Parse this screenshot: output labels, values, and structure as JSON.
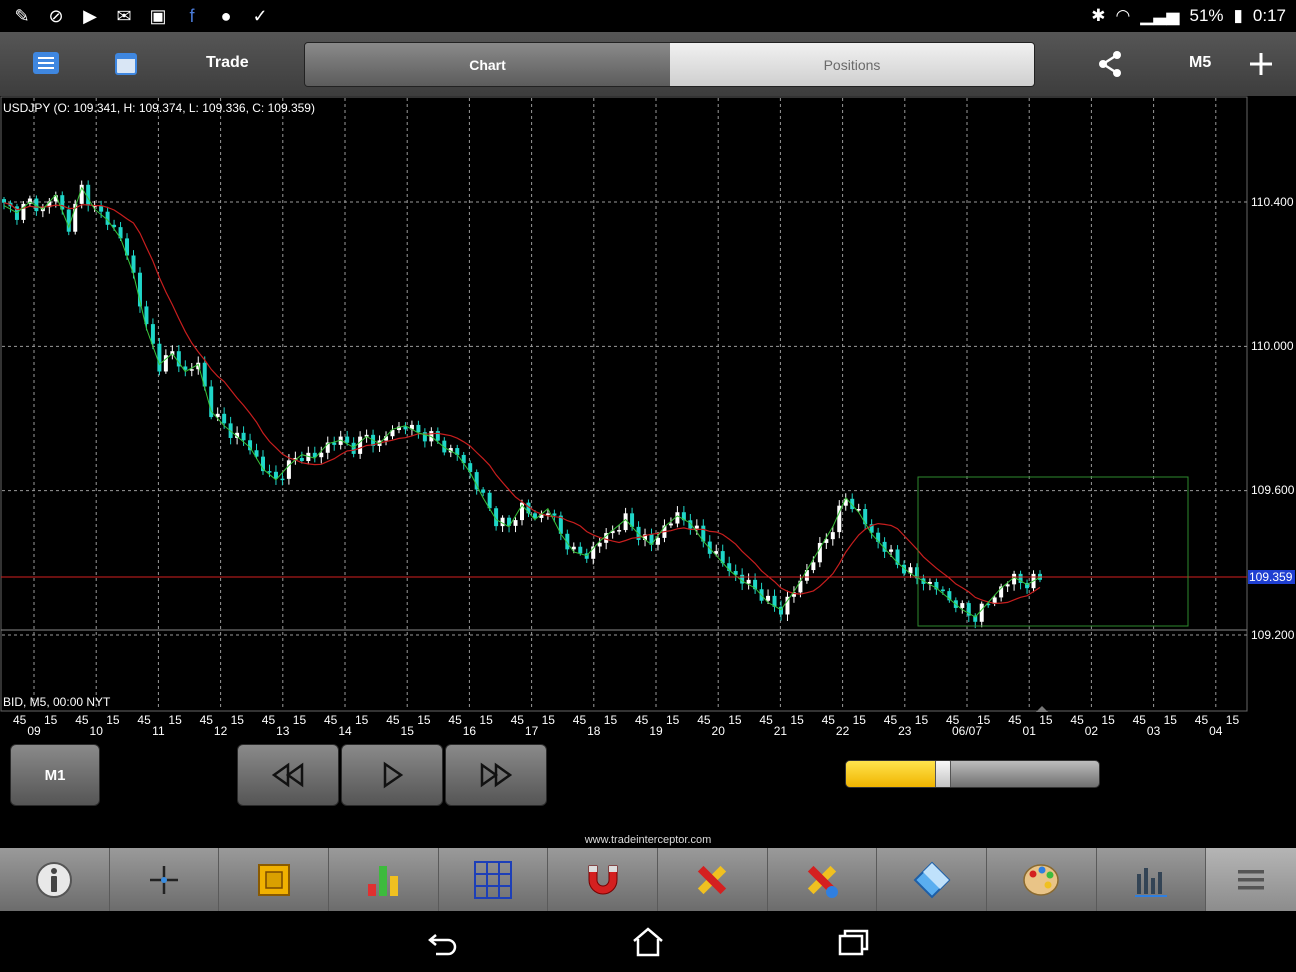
{
  "status": {
    "battery": "51%",
    "time": "0:17"
  },
  "toolbar_top": {
    "trade_label": "Trade",
    "tab_chart": "Chart",
    "tab_positions": "Positions",
    "timeframe": "M5"
  },
  "chart": {
    "header": "USDJPY (O: 109.341, H: 109.374, L: 109.336, C: 109.359)",
    "footer": "BID, M5, 00:00 NYT",
    "price_levels": [
      "110.400",
      "110.000",
      "109.600",
      "109.200"
    ],
    "current_price": "109.359",
    "day_labels": [
      "09",
      "10",
      "11",
      "12",
      "13",
      "14",
      "15",
      "16",
      "17",
      "18",
      "19",
      "20",
      "21",
      "22",
      "23",
      "06/07",
      "01",
      "02",
      "03",
      "04"
    ],
    "minute_labels": [
      "45",
      "15"
    ]
  },
  "chart_data": {
    "type": "candlestick",
    "symbol": "USDJPY",
    "ylim": [
      109.0,
      110.55
    ],
    "last": 109.359,
    "ticks": [
      110.4,
      110.0,
      109.6,
      109.2
    ],
    "closes": [
      110.39,
      110.37,
      110.4,
      110.38,
      110.42,
      110.33,
      110.44,
      110.38,
      110.35,
      110.3,
      110.2,
      110.05,
      109.95,
      109.98,
      109.93,
      109.95,
      109.82,
      109.78,
      109.75,
      109.72,
      109.66,
      109.63,
      109.67,
      109.7,
      109.69,
      109.73,
      109.74,
      109.72,
      109.75,
      109.73,
      109.77,
      109.78,
      109.76,
      109.75,
      109.72,
      109.7,
      109.65,
      109.58,
      109.52,
      109.5,
      109.56,
      109.52,
      109.55,
      109.48,
      109.43,
      109.42,
      109.46,
      109.49,
      109.52,
      109.48,
      109.45,
      109.5,
      109.53,
      109.51,
      109.46,
      109.42,
      109.38,
      109.35,
      109.33,
      109.29,
      109.27,
      109.32,
      109.38,
      109.44,
      109.5,
      109.58,
      109.54,
      109.48,
      109.44,
      109.4,
      109.37,
      109.35,
      109.33,
      109.3,
      109.27,
      109.25,
      109.29,
      109.33,
      109.36,
      109.34,
      109.36
    ],
    "close_indices": [
      0,
      2,
      4,
      6,
      8,
      10,
      12,
      14,
      16,
      18,
      20,
      22,
      24,
      26,
      28,
      30,
      32,
      34,
      36,
      38,
      40,
      42,
      44,
      46,
      48,
      50,
      52,
      54,
      56,
      58,
      60,
      62,
      64,
      66,
      68,
      70,
      72,
      74,
      76,
      78,
      80,
      82,
      84,
      86,
      88,
      90,
      92,
      94,
      96,
      98,
      100,
      102,
      104,
      106,
      108,
      110,
      112,
      114,
      116,
      118,
      120,
      122,
      124,
      126,
      128,
      130,
      132,
      134,
      136,
      138,
      140,
      142,
      144,
      146,
      148,
      150,
      152,
      154,
      156,
      158,
      160
    ]
  },
  "controls": {
    "timeframe_btn": "M1",
    "slider_value": 0.38
  },
  "footer": {
    "site": "www.tradeinterceptor.com"
  }
}
